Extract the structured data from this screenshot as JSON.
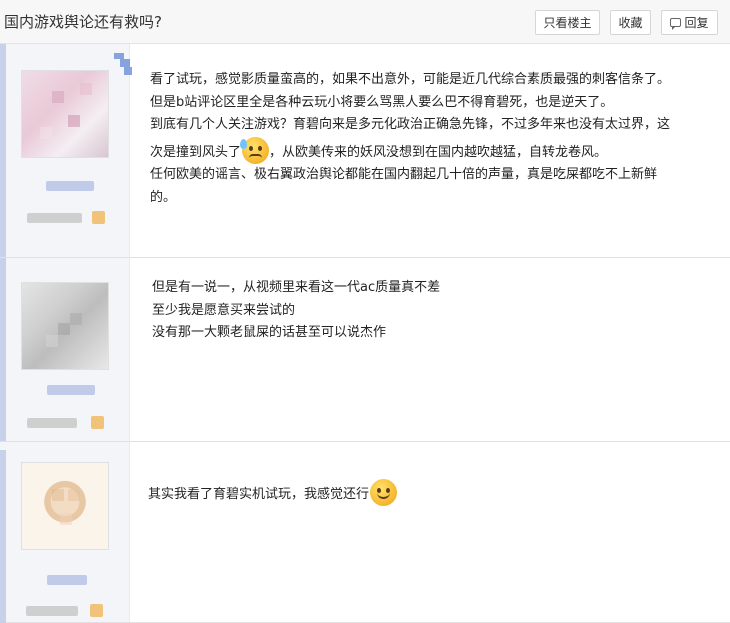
{
  "thread": {
    "title": "国内游戏舆论还有救吗?",
    "buttons": {
      "only_op": "只看楼主",
      "favorite": "收藏",
      "reply": "回复"
    }
  },
  "posts": [
    {
      "lines": [
        "看了试玩，感觉影质量蛮高的，如果不出意外，可能是近几代综合素质最强的刺客信条了。",
        "但是b站评论区里全是各种云玩小将要么骂黑人要么巴不得育碧死，也是逆天了。",
        "到底有几个人关注游戏？育碧向来是多元化政治正确急先锋，不过多年来也没有太过界，这",
        "次是撞到风头了",
        "，从欧美传来的妖风没想到在国内越吹越猛，自转龙卷风。",
        "任何欧美的谣言、极右翼政治舆论都能在国内翻起几十倍的声量，真是吃屎都吃不上新鲜",
        "的。"
      ],
      "emoji": "sweat-emoji"
    },
    {
      "lines": [
        "但是有一说一，从视频里来看这一代ac质量真不差",
        "至少我是愿意买来尝试的",
        "没有那一大颗老鼠屎的话甚至可以说杰作"
      ]
    },
    {
      "lines": [
        "其实我看了育碧实机试玩，我感觉还行"
      ],
      "emoji": "smile-emoji"
    }
  ],
  "colors": {
    "header_bg": "#f7f7f7",
    "sidebar_bg": "#f4f5f8",
    "accent": "#c7d2ea",
    "text": "#222222"
  }
}
